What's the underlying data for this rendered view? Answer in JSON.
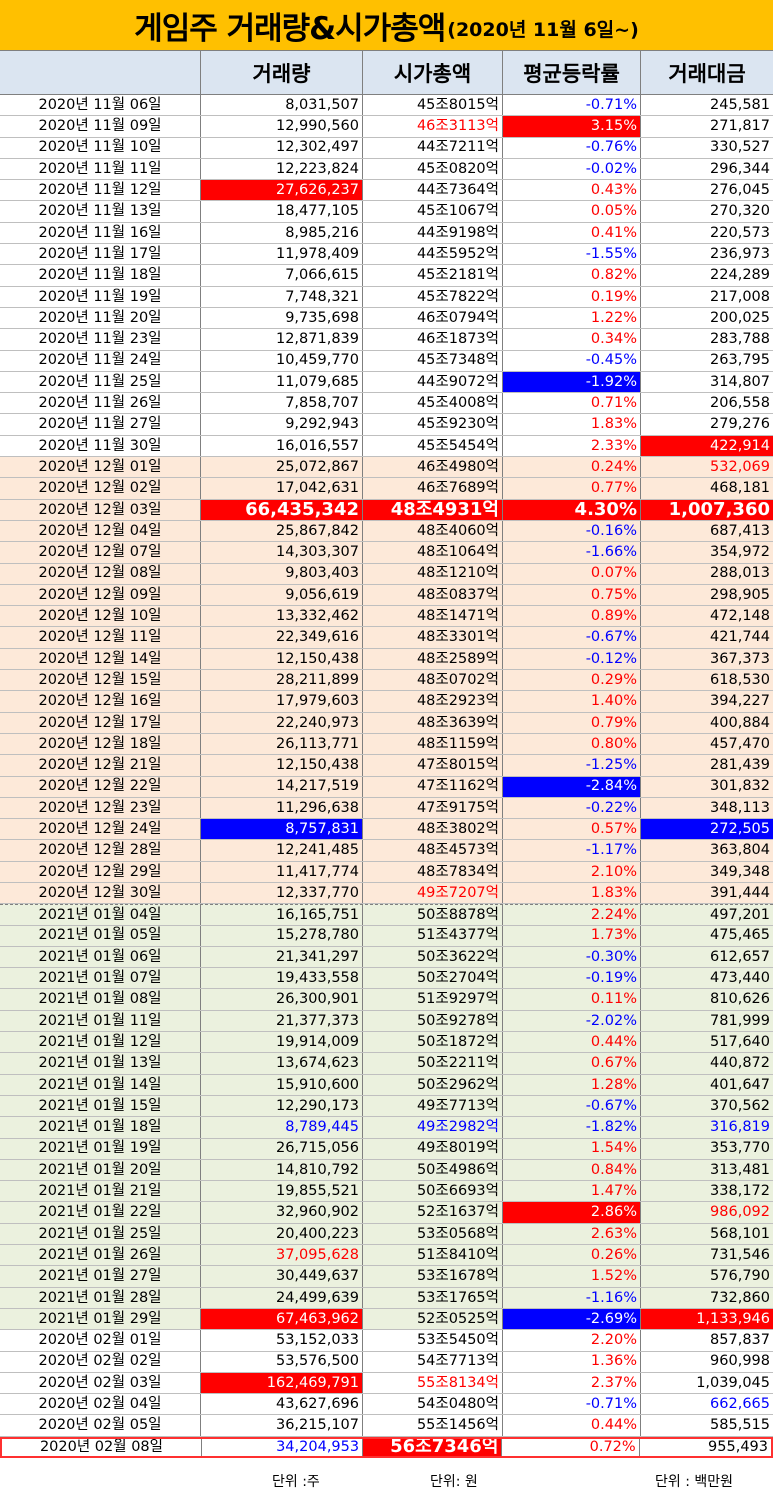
{
  "title": {
    "main": "게임주 거래량&시가총액",
    "sub": "(2020년 11월 6일~)"
  },
  "headers": [
    "",
    "거래량",
    "시가총액",
    "평균등락률",
    "거래대금"
  ],
  "rows": [
    {
      "date": "2020년 11월 06일",
      "vol": "8,031,507",
      "cap": "45조8015억",
      "rate": "-0.71%",
      "amt": "245,581",
      "g": "nov"
    },
    {
      "date": "2020년 11월 09일",
      "vol": "12,990,560",
      "cap": "46조3113억",
      "rate": "3.15%",
      "amt": "271,817",
      "g": "nov",
      "capc": "t-red",
      "ratec": "hl-red"
    },
    {
      "date": "2020년 11월 10일",
      "vol": "12,302,497",
      "cap": "44조7211억",
      "rate": "-0.76%",
      "amt": "330,527",
      "g": "nov"
    },
    {
      "date": "2020년 11월 11일",
      "vol": "12,223,824",
      "cap": "45조0820억",
      "rate": "-0.02%",
      "amt": "296,344",
      "g": "nov"
    },
    {
      "date": "2020년 11월 12일",
      "vol": "27,626,237",
      "cap": "44조7364억",
      "rate": "0.43%",
      "amt": "276,045",
      "g": "nov",
      "volc": "hl-red"
    },
    {
      "date": "2020년 11월 13일",
      "vol": "18,477,105",
      "cap": "45조1067억",
      "rate": "0.05%",
      "amt": "270,320",
      "g": "nov"
    },
    {
      "date": "2020년 11월 16일",
      "vol": "8,985,216",
      "cap": "44조9198억",
      "rate": "0.41%",
      "amt": "220,573",
      "g": "nov"
    },
    {
      "date": "2020년 11월 17일",
      "vol": "11,978,409",
      "cap": "44조5952억",
      "rate": "-1.55%",
      "amt": "236,973",
      "g": "nov"
    },
    {
      "date": "2020년 11월 18일",
      "vol": "7,066,615",
      "cap": "45조2181억",
      "rate": "0.82%",
      "amt": "224,289",
      "g": "nov"
    },
    {
      "date": "2020년 11월 19일",
      "vol": "7,748,321",
      "cap": "45조7822억",
      "rate": "0.19%",
      "amt": "217,008",
      "g": "nov"
    },
    {
      "date": "2020년 11월 20일",
      "vol": "9,735,698",
      "cap": "46조0794억",
      "rate": "1.22%",
      "amt": "200,025",
      "g": "nov"
    },
    {
      "date": "2020년 11월 23일",
      "vol": "12,871,839",
      "cap": "46조1873억",
      "rate": "0.34%",
      "amt": "283,788",
      "g": "nov"
    },
    {
      "date": "2020년 11월 24일",
      "vol": "10,459,770",
      "cap": "45조7348억",
      "rate": "-0.45%",
      "amt": "263,795",
      "g": "nov"
    },
    {
      "date": "2020년 11월 25일",
      "vol": "11,079,685",
      "cap": "44조9072억",
      "rate": "-1.92%",
      "amt": "314,807",
      "g": "nov",
      "ratec": "hl-blue"
    },
    {
      "date": "2020년 11월 26일",
      "vol": "7,858,707",
      "cap": "45조4008억",
      "rate": "0.71%",
      "amt": "206,558",
      "g": "nov"
    },
    {
      "date": "2020년 11월 27일",
      "vol": "9,292,943",
      "cap": "45조9230억",
      "rate": "1.83%",
      "amt": "279,276",
      "g": "nov"
    },
    {
      "date": "2020년 11월 30일",
      "vol": "16,016,557",
      "cap": "45조5454억",
      "rate": "2.33%",
      "amt": "422,914",
      "g": "nov",
      "amtc": "hl-red"
    },
    {
      "date": "2020년 12월 01일",
      "vol": "25,072,867",
      "cap": "46조4980억",
      "rate": "0.24%",
      "amt": "532,069",
      "g": "dec",
      "amtc": "t-red"
    },
    {
      "date": "2020년 12월 02일",
      "vol": "17,042,631",
      "cap": "46조7689억",
      "rate": "0.77%",
      "amt": "468,181",
      "g": "dec"
    },
    {
      "date": "2020년 12월 03일",
      "vol": "66,435,342",
      "cap": "48조4931억",
      "rate": "4.30%",
      "amt": "1,007,360",
      "g": "dec",
      "volc": "hl-red big",
      "capc": "hl-red big",
      "ratec": "hl-red big",
      "amtc": "hl-red big"
    },
    {
      "date": "2020년 12월 04일",
      "vol": "25,867,842",
      "cap": "48조4060억",
      "rate": "-0.16%",
      "amt": "687,413",
      "g": "dec"
    },
    {
      "date": "2020년 12월 07일",
      "vol": "14,303,307",
      "cap": "48조1064억",
      "rate": "-1.66%",
      "amt": "354,972",
      "g": "dec"
    },
    {
      "date": "2020년 12월 08일",
      "vol": "9,803,403",
      "cap": "48조1210억",
      "rate": "0.07%",
      "amt": "288,013",
      "g": "dec"
    },
    {
      "date": "2020년 12월 09일",
      "vol": "9,056,619",
      "cap": "48조0837억",
      "rate": "0.75%",
      "amt": "298,905",
      "g": "dec"
    },
    {
      "date": "2020년 12월 10일",
      "vol": "13,332,462",
      "cap": "48조1471억",
      "rate": "0.89%",
      "amt": "472,148",
      "g": "dec"
    },
    {
      "date": "2020년 12월 11일",
      "vol": "22,349,616",
      "cap": "48조3301억",
      "rate": "-0.67%",
      "amt": "421,744",
      "g": "dec"
    },
    {
      "date": "2020년 12월 14일",
      "vol": "12,150,438",
      "cap": "48조2589억",
      "rate": "-0.12%",
      "amt": "367,373",
      "g": "dec"
    },
    {
      "date": "2020년 12월 15일",
      "vol": "28,211,899",
      "cap": "48조0702억",
      "rate": "0.29%",
      "amt": "618,530",
      "g": "dec"
    },
    {
      "date": "2020년 12월 16일",
      "vol": "17,979,603",
      "cap": "48조2923억",
      "rate": "1.40%",
      "amt": "394,227",
      "g": "dec"
    },
    {
      "date": "2020년 12월 17일",
      "vol": "22,240,973",
      "cap": "48조3639억",
      "rate": "0.79%",
      "amt": "400,884",
      "g": "dec"
    },
    {
      "date": "2020년 12월 18일",
      "vol": "26,113,771",
      "cap": "48조1159억",
      "rate": "0.80%",
      "amt": "457,470",
      "g": "dec"
    },
    {
      "date": "2020년 12월 21일",
      "vol": "12,150,438",
      "cap": "47조8015억",
      "rate": "-1.25%",
      "amt": "281,439",
      "g": "dec"
    },
    {
      "date": "2020년 12월 22일",
      "vol": "14,217,519",
      "cap": "47조1162억",
      "rate": "-2.84%",
      "amt": "301,832",
      "g": "dec",
      "ratec": "hl-blue"
    },
    {
      "date": "2020년 12월 23일",
      "vol": "11,296,638",
      "cap": "47조9175억",
      "rate": "-0.22%",
      "amt": "348,113",
      "g": "dec"
    },
    {
      "date": "2020년 12월 24일",
      "vol": "8,757,831",
      "cap": "48조3802억",
      "rate": "0.57%",
      "amt": "272,505",
      "g": "dec",
      "volc": "hl-blue",
      "amtc": "hl-blue"
    },
    {
      "date": "2020년 12월 28일",
      "vol": "12,241,485",
      "cap": "48조4573억",
      "rate": "-1.17%",
      "amt": "363,804",
      "g": "dec"
    },
    {
      "date": "2020년 12월 29일",
      "vol": "11,417,774",
      "cap": "48조7834억",
      "rate": "2.10%",
      "amt": "349,348",
      "g": "dec"
    },
    {
      "date": "2020년 12월 30일",
      "vol": "12,337,770",
      "cap": "49조7207억",
      "rate": "1.83%",
      "amt": "391,444",
      "g": "dec",
      "capc": "t-red"
    },
    {
      "date": "2021년 01월 04일",
      "vol": "16,165,751",
      "cap": "50조8878억",
      "rate": "2.24%",
      "amt": "497,201",
      "g": "jan",
      "dash": true
    },
    {
      "date": "2021년 01월 05일",
      "vol": "15,278,780",
      "cap": "51조4377억",
      "rate": "1.73%",
      "amt": "475,465",
      "g": "jan"
    },
    {
      "date": "2021년 01월 06일",
      "vol": "21,341,297",
      "cap": "50조3622억",
      "rate": "-0.30%",
      "amt": "612,657",
      "g": "jan"
    },
    {
      "date": "2021년 01월 07일",
      "vol": "19,433,558",
      "cap": "50조2704억",
      "rate": "-0.19%",
      "amt": "473,440",
      "g": "jan"
    },
    {
      "date": "2021년 01월 08일",
      "vol": "26,300,901",
      "cap": "51조9297억",
      "rate": "0.11%",
      "amt": "810,626",
      "g": "jan"
    },
    {
      "date": "2021년 01월 11일",
      "vol": "21,377,373",
      "cap": "50조9278억",
      "rate": "-2.02%",
      "amt": "781,999",
      "g": "jan"
    },
    {
      "date": "2021년 01월 12일",
      "vol": "19,914,009",
      "cap": "50조1872억",
      "rate": "0.44%",
      "amt": "517,640",
      "g": "jan"
    },
    {
      "date": "2021년 01월 13일",
      "vol": "13,674,623",
      "cap": "50조2211억",
      "rate": "0.67%",
      "amt": "440,872",
      "g": "jan"
    },
    {
      "date": "2021년 01월 14일",
      "vol": "15,910,600",
      "cap": "50조2962억",
      "rate": "1.28%",
      "amt": "401,647",
      "g": "jan"
    },
    {
      "date": "2021년 01월 15일",
      "vol": "12,290,173",
      "cap": "49조7713억",
      "rate": "-0.67%",
      "amt": "370,562",
      "g": "jan"
    },
    {
      "date": "2021년 01월 18일",
      "vol": "8,789,445",
      "cap": "49조2982억",
      "rate": "-1.82%",
      "amt": "316,819",
      "g": "jan",
      "volc": "t-blue",
      "capc": "t-blue",
      "amtc": "t-blue"
    },
    {
      "date": "2021년 01월 19일",
      "vol": "26,715,056",
      "cap": "49조8019억",
      "rate": "1.54%",
      "amt": "353,770",
      "g": "jan"
    },
    {
      "date": "2021년 01월 20일",
      "vol": "14,810,792",
      "cap": "50조4986억",
      "rate": "0.84%",
      "amt": "313,481",
      "g": "jan"
    },
    {
      "date": "2021년 01월 21일",
      "vol": "19,855,521",
      "cap": "50조6693억",
      "rate": "1.47%",
      "amt": "338,172",
      "g": "jan"
    },
    {
      "date": "2021년 01월 22일",
      "vol": "32,960,902",
      "cap": "52조1637억",
      "rate": "2.86%",
      "amt": "986,092",
      "g": "jan",
      "ratec": "hl-red",
      "amtc": "t-red"
    },
    {
      "date": "2021년 01월 25일",
      "vol": "20,400,223",
      "cap": "53조0568억",
      "rate": "2.63%",
      "amt": "568,101",
      "g": "jan"
    },
    {
      "date": "2021년 01월 26일",
      "vol": "37,095,628",
      "cap": "51조8410억",
      "rate": "0.26%",
      "amt": "731,546",
      "g": "jan",
      "volc": "t-red"
    },
    {
      "date": "2021년 01월 27일",
      "vol": "30,449,637",
      "cap": "53조1678억",
      "rate": "1.52%",
      "amt": "576,790",
      "g": "jan"
    },
    {
      "date": "2021년 01월 28일",
      "vol": "24,499,639",
      "cap": "53조1765억",
      "rate": "-1.16%",
      "amt": "732,860",
      "g": "jan"
    },
    {
      "date": "2021년 01월 29일",
      "vol": "67,463,962",
      "cap": "52조0525억",
      "rate": "-2.69%",
      "amt": "1,133,946",
      "g": "jan",
      "volc": "hl-red",
      "ratec": "hl-blue",
      "amtc": "hl-red"
    },
    {
      "date": "2020년 02월 01일",
      "vol": "53,152,033",
      "cap": "53조5450억",
      "rate": "2.20%",
      "amt": "857,837",
      "g": "nov"
    },
    {
      "date": "2020년 02월 02일",
      "vol": "53,576,500",
      "cap": "54조7713억",
      "rate": "1.36%",
      "amt": "960,998",
      "g": "nov"
    },
    {
      "date": "2020년 02월 03일",
      "vol": "162,469,791",
      "cap": "55조8134억",
      "rate": "2.37%",
      "amt": "1,039,045",
      "g": "nov",
      "volc": "hl-red",
      "capc": "t-red",
      "amtc": "plain"
    },
    {
      "date": "2020년 02월 04일",
      "vol": "43,627,696",
      "cap": "54조0480억",
      "rate": "-0.71%",
      "amt": "662,665",
      "g": "nov",
      "amtc": "t-blue"
    },
    {
      "date": "2020년 02월 05일",
      "vol": "36,215,107",
      "cap": "55조1456억",
      "rate": "0.44%",
      "amt": "585,515",
      "g": "nov"
    },
    {
      "date": "2020년 02월 08일",
      "vol": "34,204,953",
      "cap": "56조7346억",
      "rate": "0.72%",
      "amt": "955,493",
      "g": "nov",
      "volc": "t-blue",
      "capc": "hl-red big",
      "last": true
    }
  ],
  "footer": {
    "unit_volume": "단위 :주",
    "unit_cap": "단위: 원",
    "unit_amount": "단위 : 백만원"
  },
  "colors": {
    "title_bg": "#ffc000",
    "header_bg": "#dbe5f1",
    "dec_bg": "#fde9d9",
    "jan_bg": "#ebf1de",
    "highlight_red": "#ff0000",
    "highlight_blue": "#0000ff"
  }
}
